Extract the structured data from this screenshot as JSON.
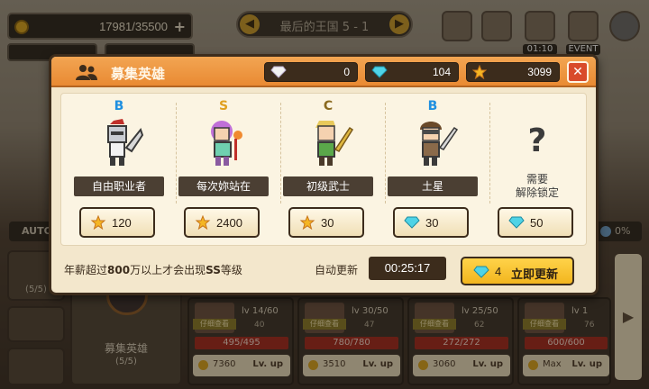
{
  "topbar": {
    "gold": "17981/35500",
    "stage": "最后的王国 5 - 1",
    "stage_prev": "◀",
    "stage_next": "▶",
    "timer_caption": "01:10",
    "event_caption": "EVENT",
    "auto_label": "AUTO",
    "percent": "0%"
  },
  "left_rail": {
    "party_count": "(5/5)"
  },
  "recruit_panel": {
    "title": "募集英雄",
    "count": "(5/5)"
  },
  "hero_cards": [
    {
      "tag": "仔细查看",
      "level": "lv 14/60",
      "sub": "40",
      "hp": "495/495",
      "cost": "7360",
      "action": "Lv. up"
    },
    {
      "tag": "仔细查看",
      "level": "lv 30/50",
      "sub": "47",
      "hp": "780/780",
      "cost": "3510",
      "action": "Lv. up"
    },
    {
      "tag": "仔细查看",
      "level": "lv 25/50",
      "sub": "62",
      "hp": "272/272",
      "cost": "3060",
      "action": "Lv. up"
    },
    {
      "tag": "仔细查看",
      "level": "lv 1",
      "sub": "76",
      "hp": "600/600",
      "cost": "Max",
      "action": "Lv. up"
    }
  ],
  "modal": {
    "title": "募集英雄",
    "close": "✕",
    "currencies": [
      {
        "icon": "white-diamond-icon",
        "value": "0"
      },
      {
        "icon": "blue-diamond-icon",
        "value": "104"
      },
      {
        "icon": "star-icon",
        "value": "3099"
      }
    ],
    "slots": [
      {
        "grade": "B",
        "grade_color": "#1f8fe0",
        "name": "自由职业者",
        "price_icon": "star",
        "price": "120"
      },
      {
        "grade": "S",
        "grade_color": "#e0a020",
        "name": "每次妳站在",
        "price_icon": "star",
        "price": "2400"
      },
      {
        "grade": "C",
        "grade_color": "#8a6a20",
        "name": "初级武士",
        "price_icon": "star",
        "price": "30"
      },
      {
        "grade": "B",
        "grade_color": "#1f8fe0",
        "name": "土星",
        "price_icon": "diamond",
        "price": "30"
      },
      {
        "locked": true,
        "symbol": "?",
        "text_line1": "需要",
        "text_line2": "解除锁定",
        "price_icon": "diamond",
        "price": "50"
      }
    ],
    "footer": {
      "note_pre": "年薪超过",
      "note_hl1": "800",
      "note_mid": "万以上才会出现",
      "note_hl2": "SS",
      "note_post": "等级",
      "auto_refresh_label": "自动更新",
      "timer": "00:25:17",
      "refresh_cost": "4",
      "refresh_label": "立即更新"
    }
  }
}
